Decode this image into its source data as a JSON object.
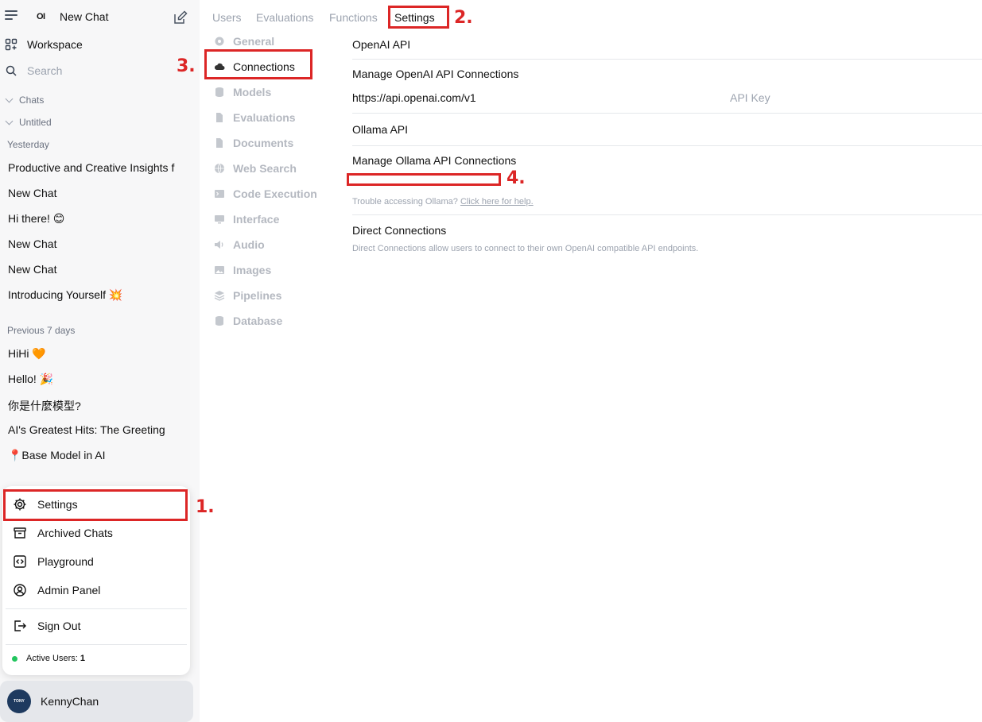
{
  "sidebar": {
    "logo": "OI",
    "new_chat": "New Chat",
    "workspace": "Workspace",
    "search_placeholder": "Search",
    "sections": {
      "chats": "Chats",
      "untitled": "Untitled"
    },
    "groups": [
      {
        "label": "Yesterday",
        "items": [
          "Productive and Creative Insights f",
          "New Chat",
          "Hi there! 😊",
          "New Chat",
          "New Chat",
          "Introducing Yourself 💥"
        ]
      },
      {
        "label": "Previous 7 days",
        "items": [
          "HiHi 🧡",
          "Hello! 🎉",
          "你是什麼模型?",
          "AI's Greatest Hits: The Greeting",
          "📍Base Model in AI"
        ]
      }
    ]
  },
  "menu": {
    "settings": "Settings",
    "archived": "Archived Chats",
    "playground": "Playground",
    "admin": "Admin Panel",
    "signout": "Sign Out",
    "active_users_label": "Active Users:",
    "active_users_count": "1"
  },
  "user": {
    "name": "KennyChan",
    "avatar_text": "TONY TRADING"
  },
  "tabs": [
    "Users",
    "Evaluations",
    "Functions",
    "Settings"
  ],
  "settings_nav": [
    {
      "label": "General",
      "icon": "gear-icon"
    },
    {
      "label": "Connections",
      "icon": "cloud-icon"
    },
    {
      "label": "Models",
      "icon": "database-icon"
    },
    {
      "label": "Evaluations",
      "icon": "document-icon"
    },
    {
      "label": "Documents",
      "icon": "document-icon"
    },
    {
      "label": "Web Search",
      "icon": "globe-icon"
    },
    {
      "label": "Code Execution",
      "icon": "terminal-icon"
    },
    {
      "label": "Interface",
      "icon": "monitor-icon"
    },
    {
      "label": "Audio",
      "icon": "speaker-icon"
    },
    {
      "label": "Images",
      "icon": "image-icon"
    },
    {
      "label": "Pipelines",
      "icon": "layers-icon"
    },
    {
      "label": "Database",
      "icon": "database-icon"
    }
  ],
  "connections": {
    "openai_title": "OpenAI API",
    "openai_manage": "Manage OpenAI API Connections",
    "openai_url": "https://api.openai.com/v1",
    "openai_key_placeholder": "API Key",
    "ollama_title": "Ollama API",
    "ollama_manage": "Manage Ollama API Connections",
    "ollama_help_text": "Trouble accessing Ollama?",
    "ollama_help_link": "Click here for help.",
    "direct_title": "Direct Connections",
    "direct_desc": "Direct Connections allow users to connect to their own OpenAI compatible API endpoints."
  },
  "annotations": [
    "1.",
    "2.",
    "3.",
    "4."
  ],
  "colors": {
    "annotation": "#dc2626",
    "active_dot": "#22c55e"
  }
}
